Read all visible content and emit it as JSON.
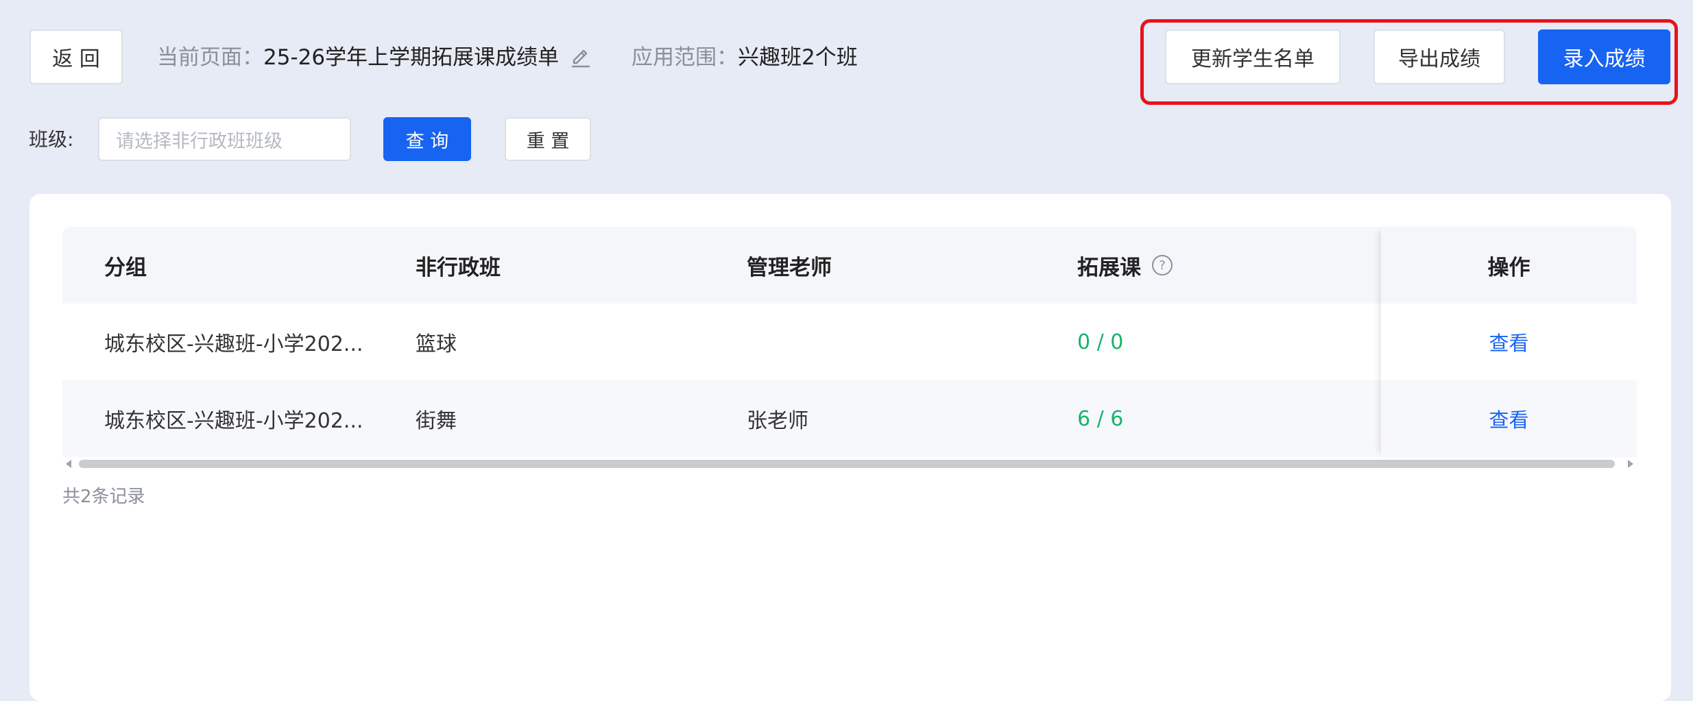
{
  "header": {
    "back_label": "返 回",
    "current_page_label": "当前页面：",
    "current_page_value": "25-26学年上学期拓展课成绩单",
    "scope_label": "应用范围：",
    "scope_value": "兴趣班2个班",
    "update_roster_label": "更新学生名单",
    "export_label": "导出成绩",
    "enter_scores_label": "录入成绩"
  },
  "filter": {
    "class_label": "班级:",
    "class_placeholder": "请选择非行政班班级",
    "query_label": "查 询",
    "reset_label": "重 置"
  },
  "table": {
    "columns": [
      "分组",
      "非行政班",
      "管理老师",
      "拓展课",
      "操作"
    ],
    "rows": [
      {
        "group": "城东校区-兴趣班-小学202...",
        "class": "篮球",
        "teacher": "",
        "course": "0 / 0",
        "action": "查看"
      },
      {
        "group": "城东校区-兴趣班-小学202...",
        "class": "街舞",
        "teacher": "张老师",
        "course": "6 / 6",
        "action": "查看"
      }
    ],
    "total_text": "共2条记录"
  },
  "colors": {
    "primary": "#1764f2",
    "success": "#19b36b",
    "highlight": "#e8121b",
    "background": "#e6ebf5"
  }
}
